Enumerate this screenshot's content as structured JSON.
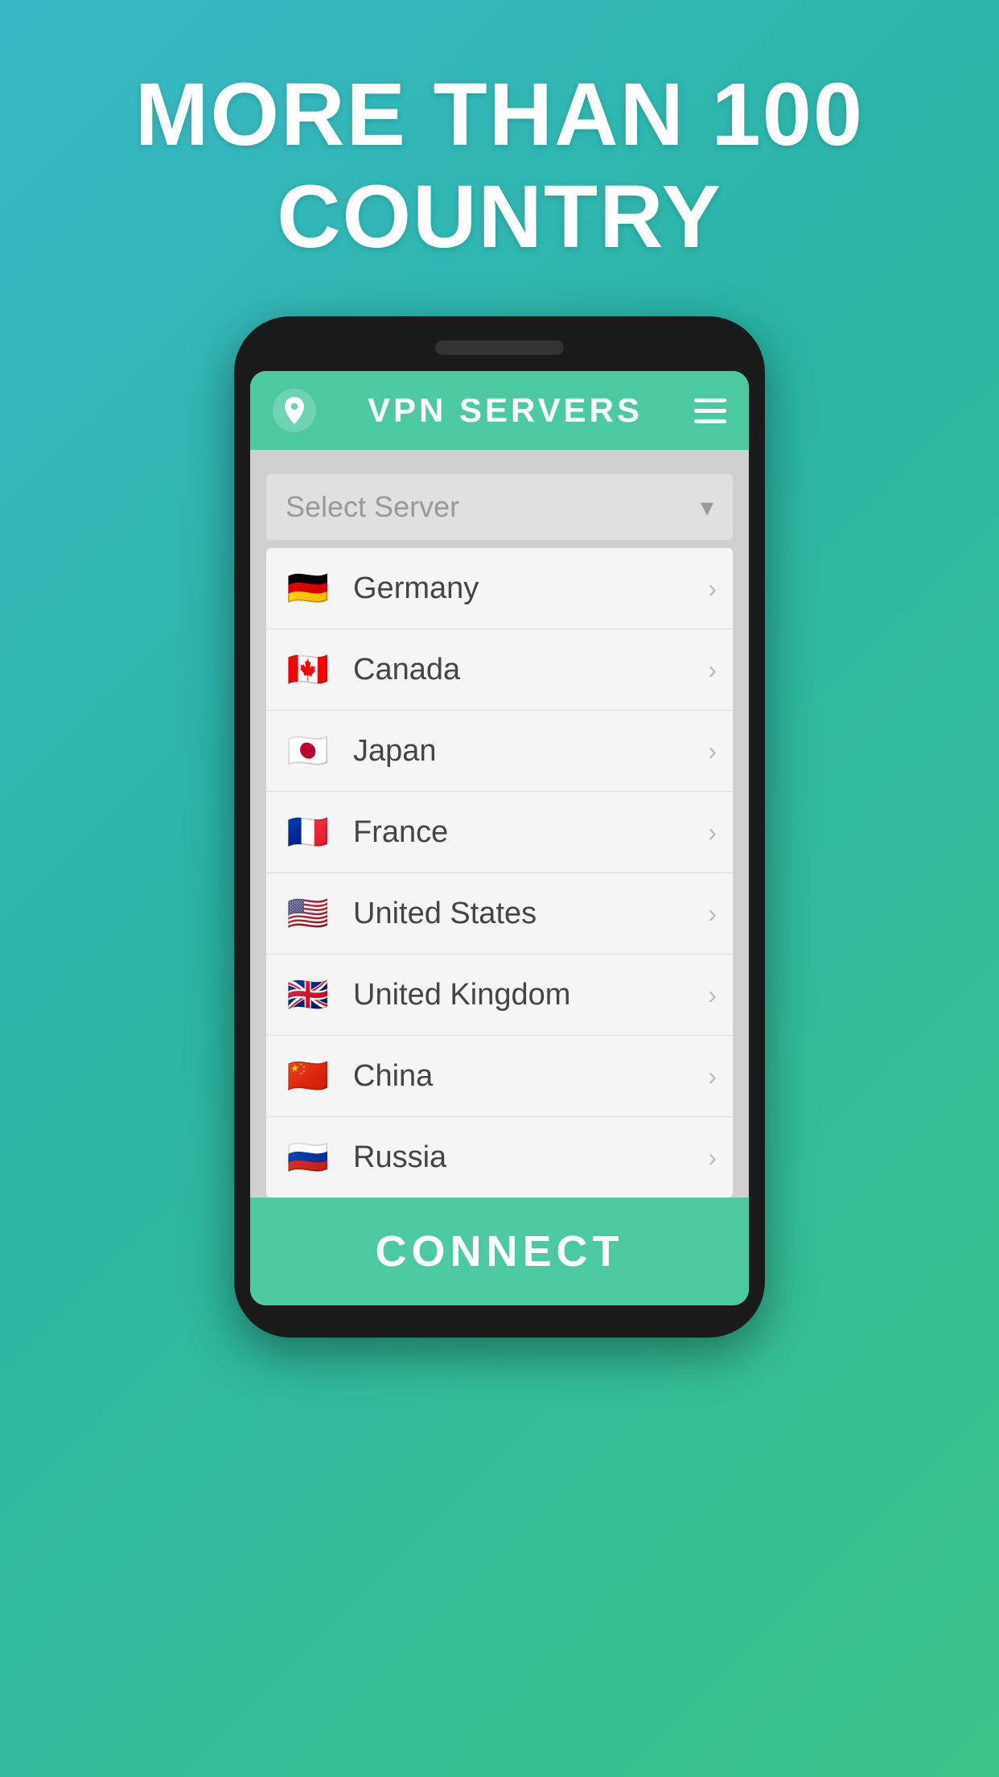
{
  "hero": {
    "title_line1": "MORE THAN 100",
    "title_line2": "COUNTRY"
  },
  "header": {
    "title": "VPN SERVERS",
    "menu_icon": "☰"
  },
  "dropdown": {
    "placeholder": "Select Server",
    "chevron": "⌄"
  },
  "countries": [
    {
      "id": "germany",
      "name": "Germany",
      "flag": "🇩🇪",
      "emoji": "🇩🇪"
    },
    {
      "id": "canada",
      "name": "Canada",
      "flag": "🇨🇦",
      "emoji": "🇨🇦"
    },
    {
      "id": "japan",
      "name": "Japan",
      "flag": "🇯🇵",
      "emoji": "🇯🇵"
    },
    {
      "id": "france",
      "name": "France",
      "flag": "🇫🇷",
      "emoji": "🇫🇷"
    },
    {
      "id": "united-states",
      "name": "United States",
      "flag": "🇺🇸",
      "emoji": "🇺🇸"
    },
    {
      "id": "united-kingdom",
      "name": "United Kingdom",
      "flag": "🇬🇧",
      "emoji": "🇬🇧"
    },
    {
      "id": "china",
      "name": "China",
      "flag": "🇨🇳",
      "emoji": "🇨🇳"
    },
    {
      "id": "russia",
      "name": "Russia",
      "flag": "🇷🇺",
      "emoji": "🇷🇺"
    }
  ],
  "connect_button": {
    "label": "CONNECT"
  }
}
